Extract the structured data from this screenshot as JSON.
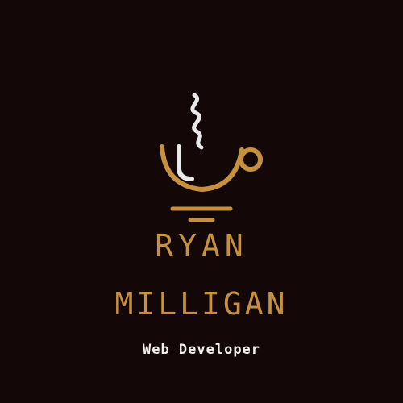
{
  "logo": {
    "icon": "coffee-cup-icon",
    "colors": {
      "background": "#130708",
      "gold": "#c5913f",
      "steam": "#e9e9ea"
    }
  },
  "name": {
    "first": "RYAN",
    "last": "MILLIGAN"
  },
  "subtitle": "Web Developer"
}
